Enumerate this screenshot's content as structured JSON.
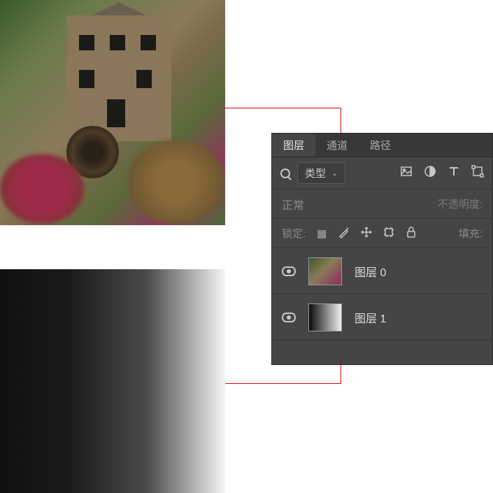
{
  "tabs": {
    "layers": "图层",
    "channels": "通道",
    "paths": "路径"
  },
  "filter": {
    "type_label": "类型"
  },
  "blend": {
    "mode": "正常",
    "opacity_label": "不透明度:"
  },
  "lock": {
    "label": "锁定:",
    "fill_label": "填充:"
  },
  "layers": [
    {
      "name": "图层 0"
    },
    {
      "name": "图层 1"
    }
  ]
}
